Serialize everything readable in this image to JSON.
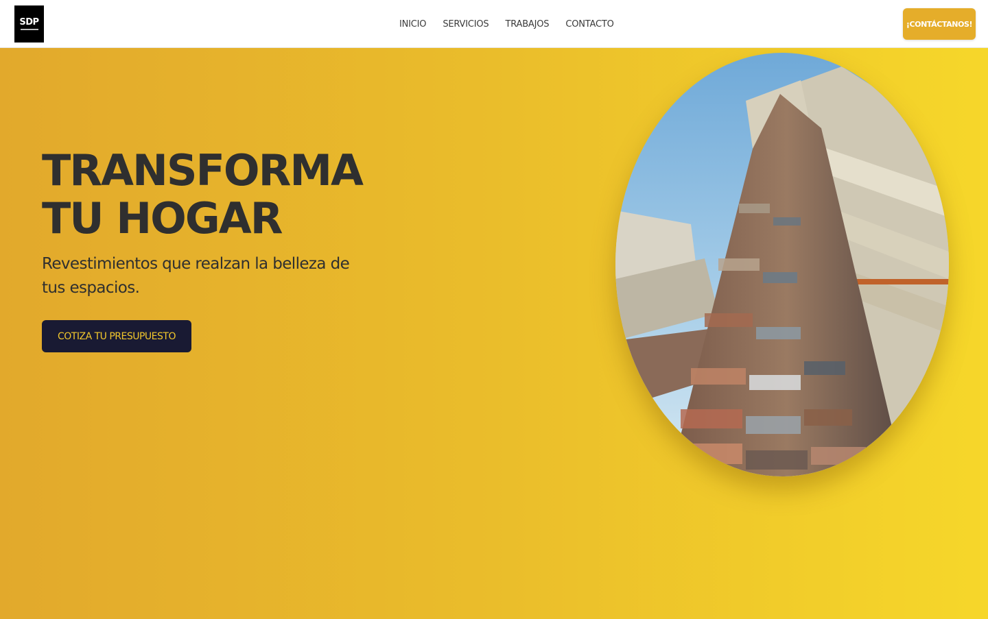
{
  "header": {
    "logo_text": "SDP",
    "nav": [
      "INICIO",
      "SERVICIOS",
      "TRABAJOS",
      "CONTACTO"
    ],
    "cta_label": "¡CONTÁCTANOS!"
  },
  "hero": {
    "title": "TRANSFORMA TU HOGAR",
    "subtitle": "Revestimientos que realzan la belleza de tus espacios.",
    "button_label": "COTIZA TU PRESUPUESTO"
  },
  "colors": {
    "accent": "#e5ad2a",
    "hero_gradient_start": "#e2a92c",
    "hero_gradient_end": "#f6d72a",
    "button_dark": "#191a33",
    "text_dark": "#2f2f2f"
  }
}
